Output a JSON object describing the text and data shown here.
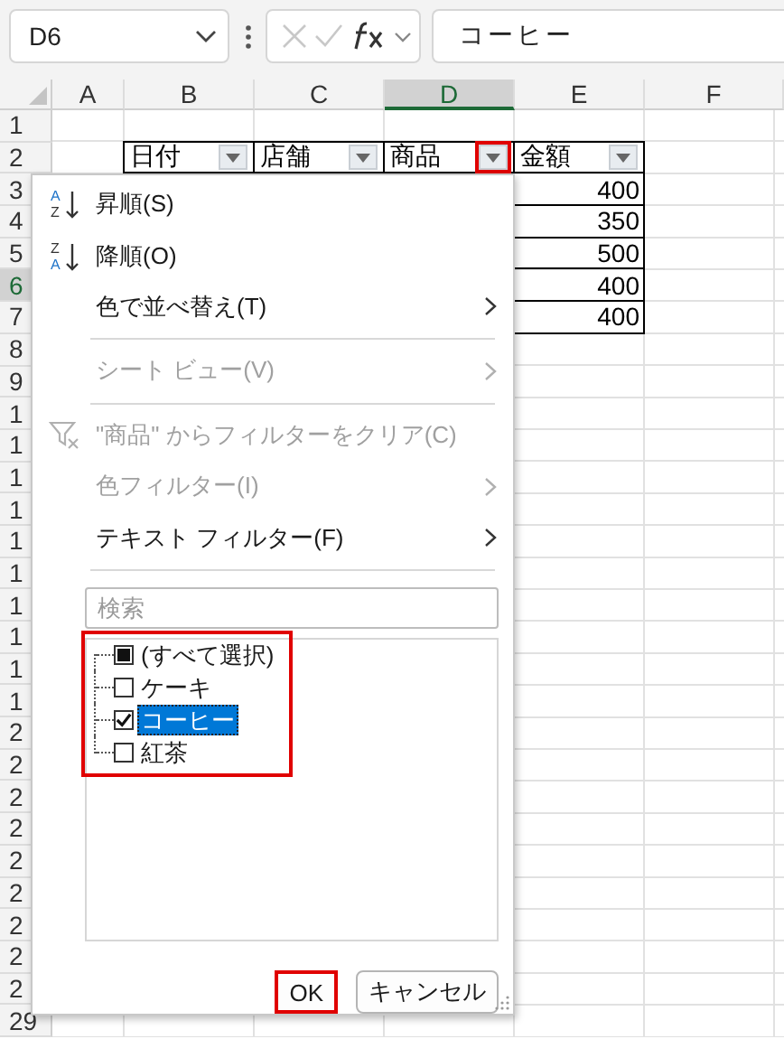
{
  "formula_bar": {
    "name_box": "D6",
    "formula": "コーヒー"
  },
  "sheet": {
    "columns": [
      {
        "label": "A",
        "selected": false
      },
      {
        "label": "B",
        "selected": false
      },
      {
        "label": "C",
        "selected": false
      },
      {
        "label": "D",
        "selected": true
      },
      {
        "label": "E",
        "selected": false
      },
      {
        "label": "F",
        "selected": false
      }
    ],
    "rows": [
      {
        "label": "1",
        "selected": false
      },
      {
        "label": "2",
        "selected": false
      },
      {
        "label": "3",
        "selected": false
      },
      {
        "label": "4",
        "selected": false
      },
      {
        "label": "5",
        "selected": false
      },
      {
        "label": "6",
        "selected": true
      },
      {
        "label": "7",
        "selected": false
      },
      {
        "label": "8",
        "selected": false
      },
      {
        "label": "9",
        "selected": false
      },
      {
        "label": "1",
        "selected": false
      },
      {
        "label": "1",
        "selected": false
      },
      {
        "label": "1",
        "selected": false
      },
      {
        "label": "1",
        "selected": false
      },
      {
        "label": "1",
        "selected": false
      },
      {
        "label": "1",
        "selected": false
      },
      {
        "label": "1",
        "selected": false
      },
      {
        "label": "1",
        "selected": false
      },
      {
        "label": "1",
        "selected": false
      },
      {
        "label": "1",
        "selected": false
      },
      {
        "label": "2",
        "selected": false
      },
      {
        "label": "2",
        "selected": false
      },
      {
        "label": "2",
        "selected": false
      },
      {
        "label": "2",
        "selected": false
      },
      {
        "label": "2",
        "selected": false
      },
      {
        "label": "2",
        "selected": false
      },
      {
        "label": "2",
        "selected": false
      },
      {
        "label": "2",
        "selected": false
      },
      {
        "label": "2",
        "selected": false
      },
      {
        "label": "29",
        "selected": false
      }
    ],
    "table_headers": [
      {
        "label": "日付",
        "highlighted": false
      },
      {
        "label": "店舗",
        "highlighted": false
      },
      {
        "label": "商品",
        "highlighted": true
      },
      {
        "label": "金額",
        "highlighted": false
      }
    ],
    "amounts": [
      "400",
      "350",
      "500",
      "400",
      "400"
    ]
  },
  "filter_menu": {
    "items": [
      {
        "kind": "sort_asc",
        "icon_letters": [
          "A",
          "Z"
        ],
        "label": "昇順(S)",
        "disabled": false,
        "submenu": false
      },
      {
        "kind": "sort_desc",
        "icon_letters": [
          "Z",
          "A"
        ],
        "label": "降順(O)",
        "disabled": false,
        "submenu": false
      },
      {
        "kind": "plain",
        "label": "色で並べ替え(T)",
        "disabled": false,
        "submenu": true
      },
      {
        "kind": "separator"
      },
      {
        "kind": "plain",
        "label": "シート ビュー(V)",
        "disabled": true,
        "submenu": true
      },
      {
        "kind": "separator"
      },
      {
        "kind": "clear_filter",
        "label": "\"商品\" からフィルターをクリア(C)",
        "disabled": true,
        "submenu": false
      },
      {
        "kind": "plain",
        "label": "色フィルター(I)",
        "disabled": true,
        "submenu": true
      },
      {
        "kind": "plain",
        "label": "テキスト フィルター(F)",
        "disabled": false,
        "submenu": true
      },
      {
        "kind": "separator"
      }
    ],
    "search": {
      "placeholder": "検索"
    },
    "list_highlighted": true,
    "values": [
      {
        "label": "(すべて選択)",
        "checked": false,
        "mixed": true,
        "selected": false
      },
      {
        "label": "ケーキ",
        "checked": false,
        "mixed": false,
        "selected": false
      },
      {
        "label": "コーヒー",
        "checked": true,
        "mixed": false,
        "selected": true
      },
      {
        "label": "紅茶",
        "checked": false,
        "mixed": false,
        "selected": false
      }
    ],
    "buttons": [
      {
        "label": "OK",
        "highlighted": true
      },
      {
        "label": "キャンセル",
        "highlighted": false
      }
    ]
  }
}
